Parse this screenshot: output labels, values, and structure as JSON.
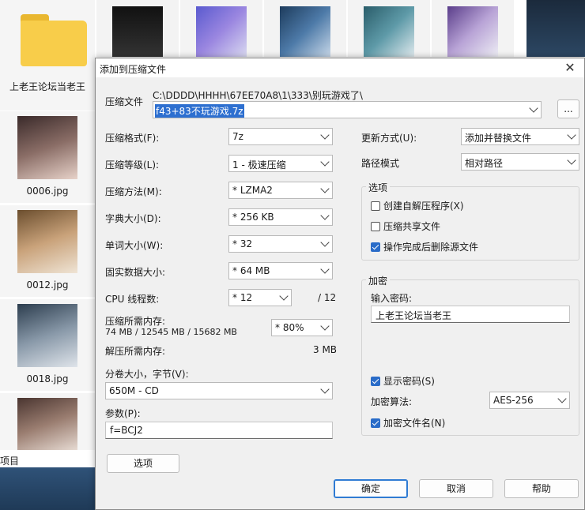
{
  "explorer": {
    "folder_label": "上老王论坛当老王",
    "files": [
      "0006.jpg",
      "0012.jpg",
      "0018.jpg"
    ],
    "status_text": "项目"
  },
  "dialog": {
    "title": "添加到压缩文件",
    "archive_label": "压缩文件",
    "archive_path": "C:\\DDDD\\HHHH\\67EE70A8\\1\\333\\别玩游戏了\\",
    "archive_name": "f43+83不玩游戏.7z",
    "browse_label": "...",
    "format_label": "压缩格式(F):",
    "format_value": "7z",
    "level_label": "压缩等级(L):",
    "level_value": "1 - 极速压缩",
    "method_label": "压缩方法(M):",
    "method_value": "* LZMA2",
    "dict_label": "字典大小(D):",
    "dict_value": "* 256 KB",
    "word_label": "单词大小(W):",
    "word_value": "* 32",
    "solid_label": "固实数据大小:",
    "solid_value": "* 64 MB",
    "cpu_label": "CPU 线程数:",
    "cpu_value": "* 12",
    "cpu_max": "/ 12",
    "mem_label": "压缩所需内存:",
    "mem_values": "74 MB / 12545 MB / 15682 MB",
    "mem_percent": "* 80%",
    "decomp_label": "解压所需内存:",
    "decomp_value": "3 MB",
    "volume_label": "分卷大小，字节(V):",
    "volume_value": "650M - CD",
    "params_label": "参数(P):",
    "params_value": "f=BCJ2",
    "options_button": "选项",
    "update_label": "更新方式(U):",
    "update_value": "添加并替换文件",
    "path_label": "路径模式",
    "path_value": "相对路径",
    "options_group": "选项",
    "sfx_label": "创建自解压程序(X)",
    "sfx_checked": false,
    "shared_label": "压缩共享文件",
    "shared_checked": false,
    "delete_label": "操作完成后删除源文件",
    "delete_checked": true,
    "encrypt_group": "加密",
    "password_label": "输入密码:",
    "password_value": "上老王论坛当老王",
    "show_pw_label": "显示密码(S)",
    "show_pw_checked": true,
    "enc_method_label": "加密算法:",
    "enc_method_value": "AES-256",
    "enc_names_label": "加密文件名(N)",
    "enc_names_checked": true,
    "ok_label": "确定",
    "cancel_label": "取消",
    "help_label": "帮助"
  },
  "colors": {
    "accent": "#2a6cc8",
    "dialog_bg": "#f0f0f0",
    "folder": "#f8cd4a"
  }
}
